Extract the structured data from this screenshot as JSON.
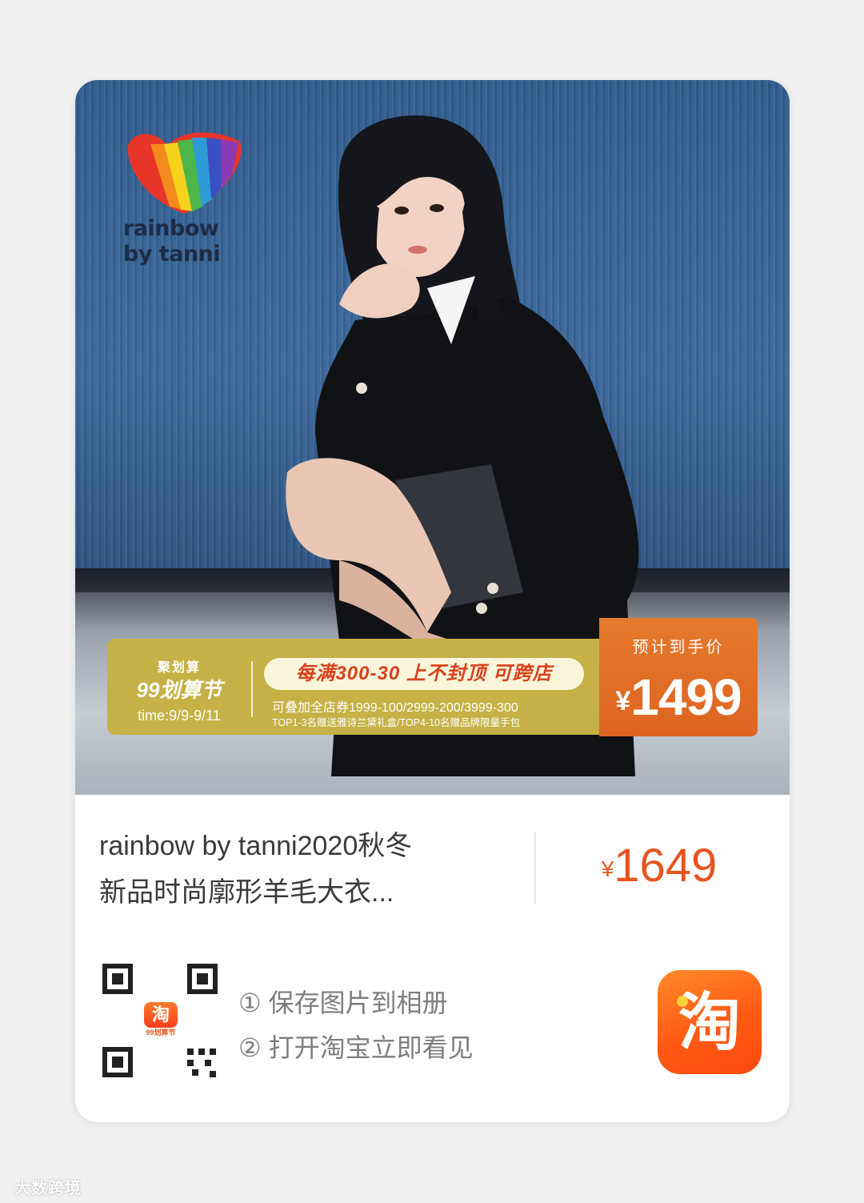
{
  "brand": {
    "line1": "rainbow",
    "line2": "by tanni"
  },
  "promo": {
    "top_label": "聚划算",
    "festival": "99划算节",
    "time": "time:9/9-9/11",
    "headline": "每满300-30 上不封顶 可跨店",
    "line1": "可叠加全店券1999-100/2999-200/3999-300",
    "line2": "TOP1-3名赠送雅诗兰黛礼盒/TOP4-10名赠品牌限量手包"
  },
  "estimated": {
    "label": "预计到手价",
    "currency": "¥",
    "value": "1499"
  },
  "product": {
    "title_line1": "rainbow by tanni2020秋冬",
    "title_line2": "新品时尚廓形羊毛大衣...",
    "currency": "¥",
    "price": "1649"
  },
  "qr": {
    "badge_char": "淘",
    "badge_sub": "99划算节"
  },
  "steps": {
    "step1": "① 保存图片到相册",
    "step2": "② 打开淘宝立即看见"
  },
  "app": {
    "char": "淘",
    "icon": "taobao-app-icon"
  },
  "watermark": "大数跨境",
  "colors": {
    "accent": "#e8541e",
    "promo_gold": "#c5b145",
    "price_orange": "#dd6420"
  }
}
